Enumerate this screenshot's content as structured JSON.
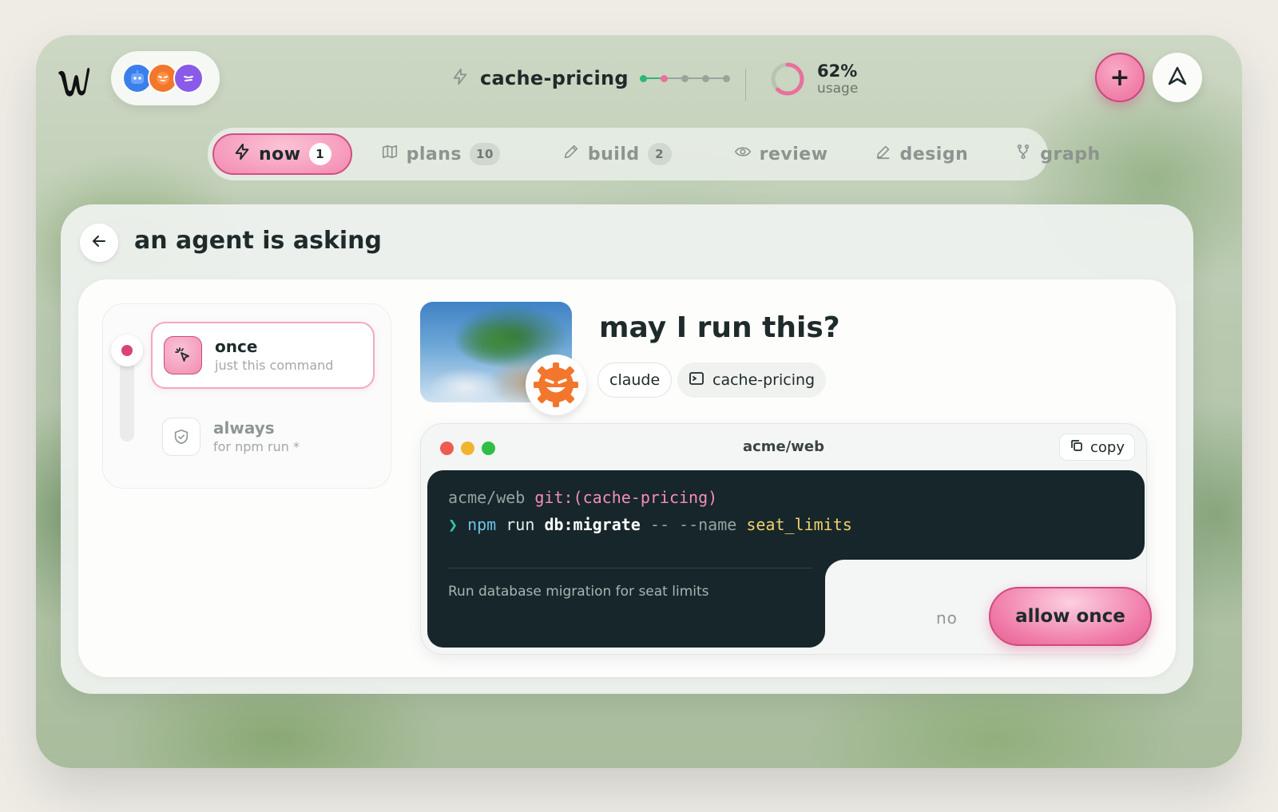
{
  "topbar": {
    "branch": "cache-pricing",
    "usage_percent": "62%",
    "usage_label": "usage",
    "usage_fraction": 0.62,
    "pipeline_steps": 5,
    "pipeline_done": 2,
    "add_label": "+"
  },
  "agents": [
    {
      "icon": "blue-robot-icon",
      "color": "#3d7fea"
    },
    {
      "icon": "orange-gear-face-icon",
      "color": "#f2762b"
    },
    {
      "icon": "purple-face-icon",
      "color": "#8a5be8"
    }
  ],
  "tabs": [
    {
      "label": "now",
      "badge": "1",
      "icon": "bolt-icon",
      "active": true
    },
    {
      "label": "plans",
      "badge": "10",
      "icon": "map-icon",
      "active": false
    },
    {
      "label": "build",
      "badge": "2",
      "icon": "pencil-icon",
      "active": false
    },
    {
      "label": "review",
      "badge": "",
      "icon": "eye-icon",
      "active": false
    },
    {
      "label": "design",
      "badge": "",
      "icon": "pen-icon",
      "active": false
    },
    {
      "label": "graph",
      "badge": "",
      "icon": "branch-icon",
      "active": false
    }
  ],
  "main": {
    "title": "an agent is asking",
    "scope": {
      "once": {
        "title": "once",
        "desc": "just this command"
      },
      "always": {
        "title": "always",
        "desc": "for npm run *"
      }
    },
    "request": {
      "question": "may I run this?",
      "agent_chip": "claude",
      "branch_chip": "cache-pricing"
    },
    "terminal": {
      "title": "acme/web",
      "copy_label": "copy",
      "path": "acme/web",
      "git": "git:(cache-pricing)",
      "prompt": "❯",
      "bin": "npm",
      "run": "run",
      "script": "db:migrate",
      "dashes": "--",
      "flag": "--name",
      "arg": "seat_limits",
      "description": "Run database migration for seat limits"
    },
    "actions": {
      "deny": "no",
      "allow": "allow once"
    }
  },
  "colors": {
    "accent_pink": "#ef7ea9",
    "terminal_bg": "#16262a"
  }
}
